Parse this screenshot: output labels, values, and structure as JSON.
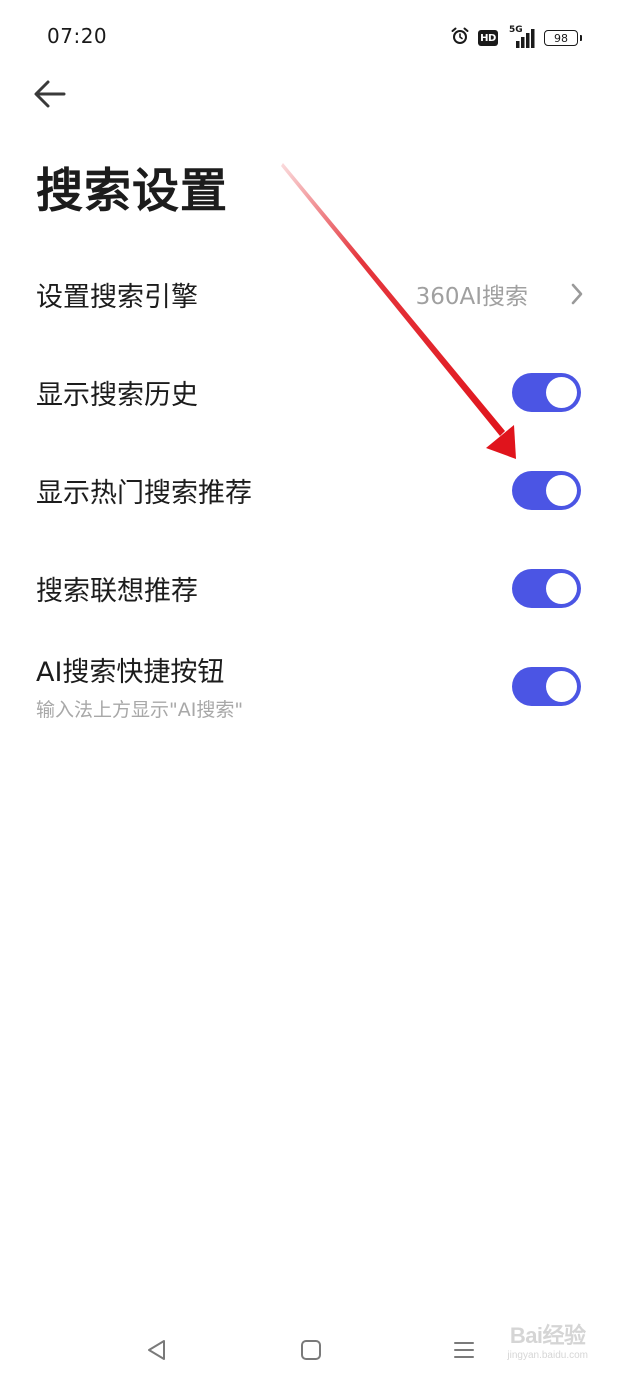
{
  "status_bar": {
    "time": "07:20",
    "hd_label": "HD",
    "network_label": "5G",
    "battery_level": "98"
  },
  "header": {
    "title": "搜索设置"
  },
  "settings": [
    {
      "label": "设置搜索引擎",
      "value": "360AI搜索",
      "type": "link"
    },
    {
      "label": "显示搜索历史",
      "type": "toggle",
      "on": true
    },
    {
      "label": "显示热门搜索推荐",
      "type": "toggle",
      "on": true
    },
    {
      "label": "搜索联想推荐",
      "type": "toggle",
      "on": true
    },
    {
      "label": "AI搜索快捷按钮",
      "sublabel": "输入法上方显示\"AI搜索\"",
      "type": "toggle",
      "on": true
    }
  ],
  "watermark": {
    "main": "Bai经验",
    "sub": "jingyan.baidu.com"
  },
  "colors": {
    "toggle_on": "#4b55e4",
    "annotation_arrow": "#e0141c"
  },
  "icons": {
    "back": "arrow-left-icon",
    "chevron": "chevron-right-icon",
    "nav_back": "triangle-back-icon",
    "nav_home": "square-home-icon",
    "nav_menu": "menu-lines-icon"
  }
}
